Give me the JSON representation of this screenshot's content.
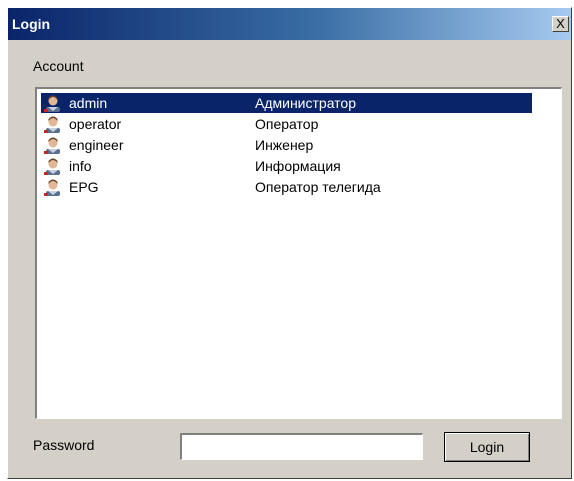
{
  "window": {
    "title": "Login",
    "close_label": "X"
  },
  "account": {
    "label": "Account",
    "users": [
      {
        "name": "admin",
        "role": "Администратор",
        "icon": "user-icon",
        "selected": true
      },
      {
        "name": "operator",
        "role": "Оператор",
        "icon": "user-icon",
        "selected": false
      },
      {
        "name": "engineer",
        "role": "Инженер",
        "icon": "user-icon",
        "selected": false
      },
      {
        "name": "info",
        "role": "Информация",
        "icon": "user-icon",
        "selected": false
      },
      {
        "name": "EPG",
        "role": "Оператор телегида",
        "icon": "user-icon",
        "selected": false
      }
    ]
  },
  "password": {
    "label": "Password",
    "value": ""
  },
  "login_button": {
    "label": "Login"
  },
  "colors": {
    "titlebar_start": "#0a246a",
    "titlebar_end": "#a6caf0",
    "dialog_face": "#d4d0c8",
    "selection": "#0a246a"
  }
}
